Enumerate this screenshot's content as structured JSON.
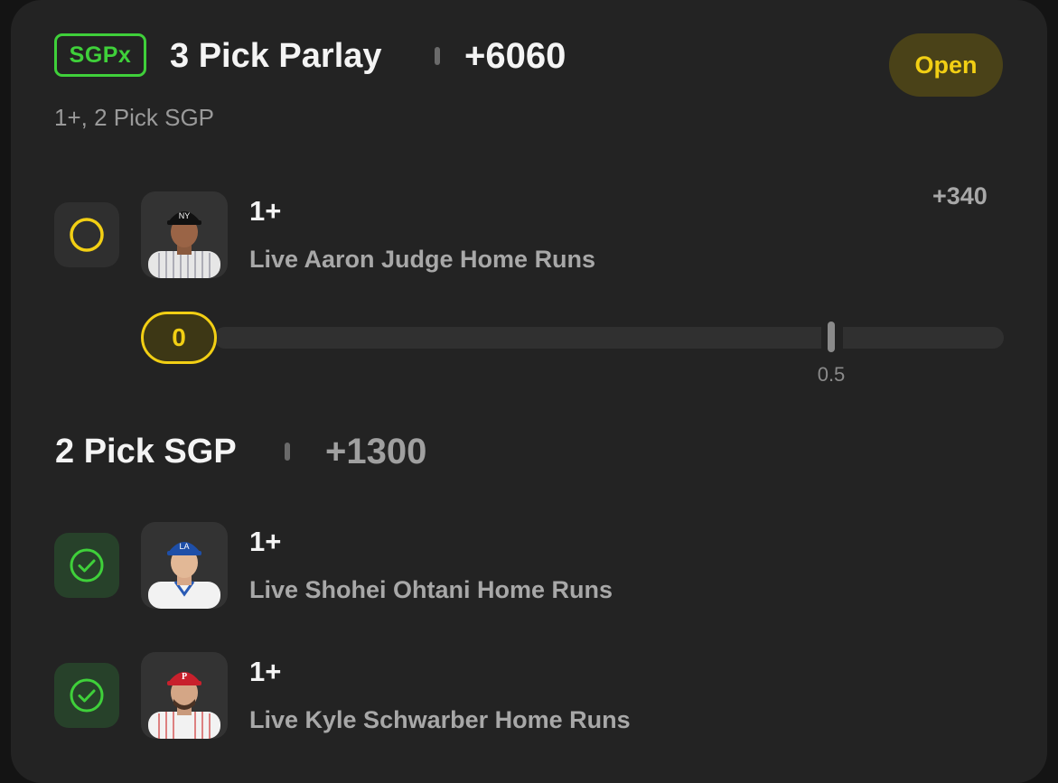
{
  "header": {
    "badge": "SGPx",
    "title": "3 Pick Parlay",
    "odds": "+6060",
    "status": "Open",
    "subtitle": "1+, 2 Pick SGP"
  },
  "leg1": {
    "line": "1+",
    "market": "Live Aaron Judge Home Runs",
    "odds": "+340",
    "status": "pending",
    "progress": {
      "current_label": "0",
      "current_value": 0,
      "target_label": "0.5",
      "target_value": 0.5
    }
  },
  "sgp": {
    "title": "2 Pick SGP",
    "odds": "+1300",
    "legs": [
      {
        "line": "1+",
        "market": "Live Shohei Ohtani Home Runs",
        "status": "won"
      },
      {
        "line": "1+",
        "market": "Live Kyle Schwarber Home Runs",
        "status": "won"
      }
    ]
  },
  "colors": {
    "card_bg": "#232323",
    "accent_green": "#3fd03a",
    "accent_yellow": "#f2cf14",
    "status_bg": "#4a4218"
  }
}
